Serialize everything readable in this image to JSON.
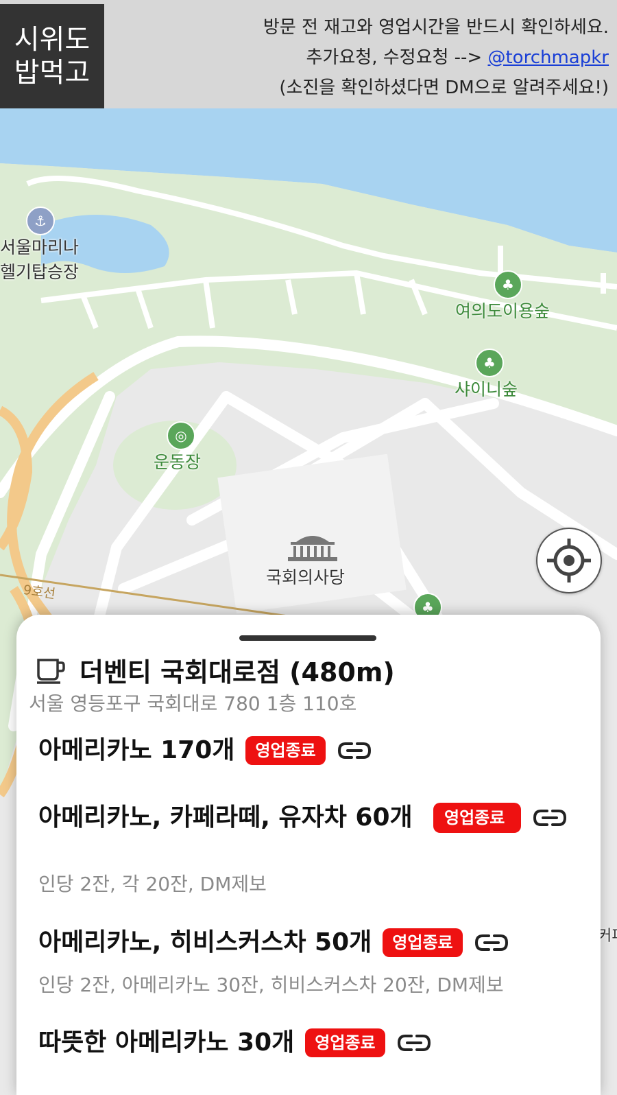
{
  "header": {
    "logo_line1": "시위도",
    "logo_line2": "밥먹고",
    "notice_line1": "방문 전 재고와 영업시간을 반드시 확인하세요.",
    "notice_line2_prefix": "추가요청, 수정요청 --> ",
    "notice_link": "@torchmapkr",
    "notice_line3": "(소진을 확인하셨다면 DM으로 알려주세요!)"
  },
  "map": {
    "labels": {
      "marina_line1": "서울마리나",
      "marina_line2": "헬기탑승장",
      "forest1": "여의도이용숲",
      "forest2": "샤이니숲",
      "stadium": "운동장",
      "assembly": "국회의사당",
      "subway_line": "9호선",
      "edge_text": "커피"
    }
  },
  "sheet": {
    "store_icon": "coffee-cup-icon",
    "store_title": "더벤티 국회대로점 (480m)",
    "address": "서울 영등포구 국회대로 780 1층 110호",
    "items": [
      {
        "name": "아메리카노 170개",
        "status": "영업종료",
        "note": ""
      },
      {
        "name": "아메리카노, 카페라떼, 유자차 60개",
        "status": "영업종료",
        "note": "인당 2잔, 각 20잔, DM제보"
      },
      {
        "name": "아메리카노, 히비스커스차 50개",
        "status": "영업종료",
        "note": "인당 2잔, 아메리카노 30잔, 히비스커스차 20잔, DM제보"
      },
      {
        "name": "따뜻한 아메리카노 30개",
        "status": "영업종료",
        "note": ""
      }
    ]
  },
  "colors": {
    "badge": "#ee1111",
    "water": "#a8d3f1",
    "park": "#dcebd3",
    "header_bg": "#d7d7d7"
  }
}
